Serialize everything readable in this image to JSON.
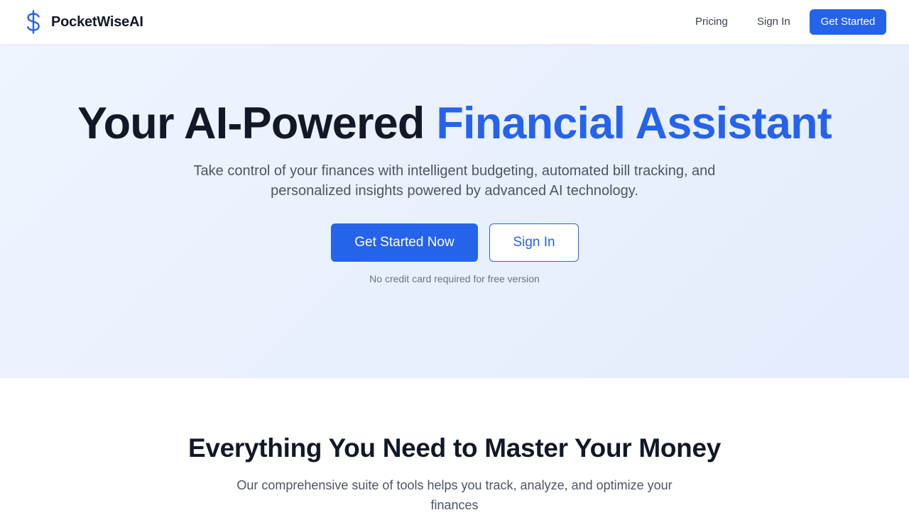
{
  "brand": {
    "name": "PocketWiseAI",
    "icon": "dollar-sign-icon",
    "accent_color": "#2563eb"
  },
  "nav": {
    "pricing": "Pricing",
    "sign_in": "Sign In",
    "get_started": "Get Started"
  },
  "hero": {
    "title_main": "Your AI-Powered",
    "title_accent": "Financial Assistant",
    "subtitle": "Take control of your finances with intelligent budgeting, automated bill tracking, and personalized insights powered by advanced AI technology.",
    "primary_cta": "Get Started Now",
    "secondary_cta": "Sign In",
    "note": "No credit card required for free version"
  },
  "features": {
    "title": "Everything You Need to Master Your Money",
    "subtitle": "Our comprehensive suite of tools helps you track, analyze, and optimize your finances"
  }
}
